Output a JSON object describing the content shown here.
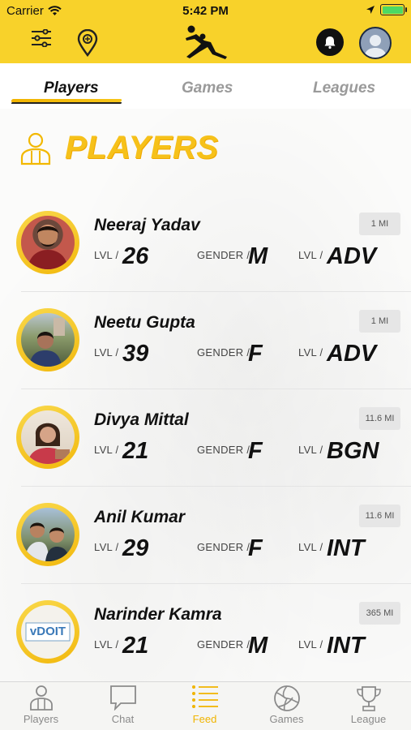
{
  "status_bar": {
    "carrier": "Carrier",
    "time": "5:42 PM"
  },
  "header": {
    "icons": [
      "filter-icon",
      "location-pin-icon",
      "volleyball-player-logo",
      "bell-icon",
      "profile-avatar"
    ]
  },
  "tabs": [
    {
      "label": "Players",
      "active": true
    },
    {
      "label": "Games",
      "active": false
    },
    {
      "label": "Leagues",
      "active": false
    }
  ],
  "section": {
    "title": "PLAYERS"
  },
  "stat_labels": {
    "level": "LVL /",
    "gender": "GENDER /",
    "level2": "LVL /"
  },
  "players": [
    {
      "name": "Neeraj Yadav",
      "distance": "1 MI",
      "level": "26",
      "gender": "M",
      "skill": "ADV"
    },
    {
      "name": "Neetu Gupta",
      "distance": "1 MI",
      "level": "39",
      "gender": "F",
      "skill": "ADV"
    },
    {
      "name": "Divya Mittal",
      "distance": "11.6 MI",
      "level": "21",
      "gender": "F",
      "skill": "BGN"
    },
    {
      "name": "Anil Kumar",
      "distance": "11.6 MI",
      "level": "29",
      "gender": "F",
      "skill": "INT"
    },
    {
      "name": "Narinder Kamra",
      "distance": "365 MI",
      "level": "21",
      "gender": "M",
      "skill": "INT",
      "avatar_text": "vDOIT"
    }
  ],
  "bottom_nav": [
    {
      "label": "Players",
      "icon": "player-icon",
      "active": false
    },
    {
      "label": "Chat",
      "icon": "chat-icon",
      "active": false
    },
    {
      "label": "Feed",
      "icon": "feed-icon",
      "active": true
    },
    {
      "label": "Games",
      "icon": "volleyball-icon",
      "active": false
    },
    {
      "label": "League",
      "icon": "trophy-icon",
      "active": false
    }
  ],
  "colors": {
    "accent": "#f8d22a",
    "title": "#f6c11a",
    "active_nav": "#f0b400",
    "battery": "#4cd964"
  }
}
